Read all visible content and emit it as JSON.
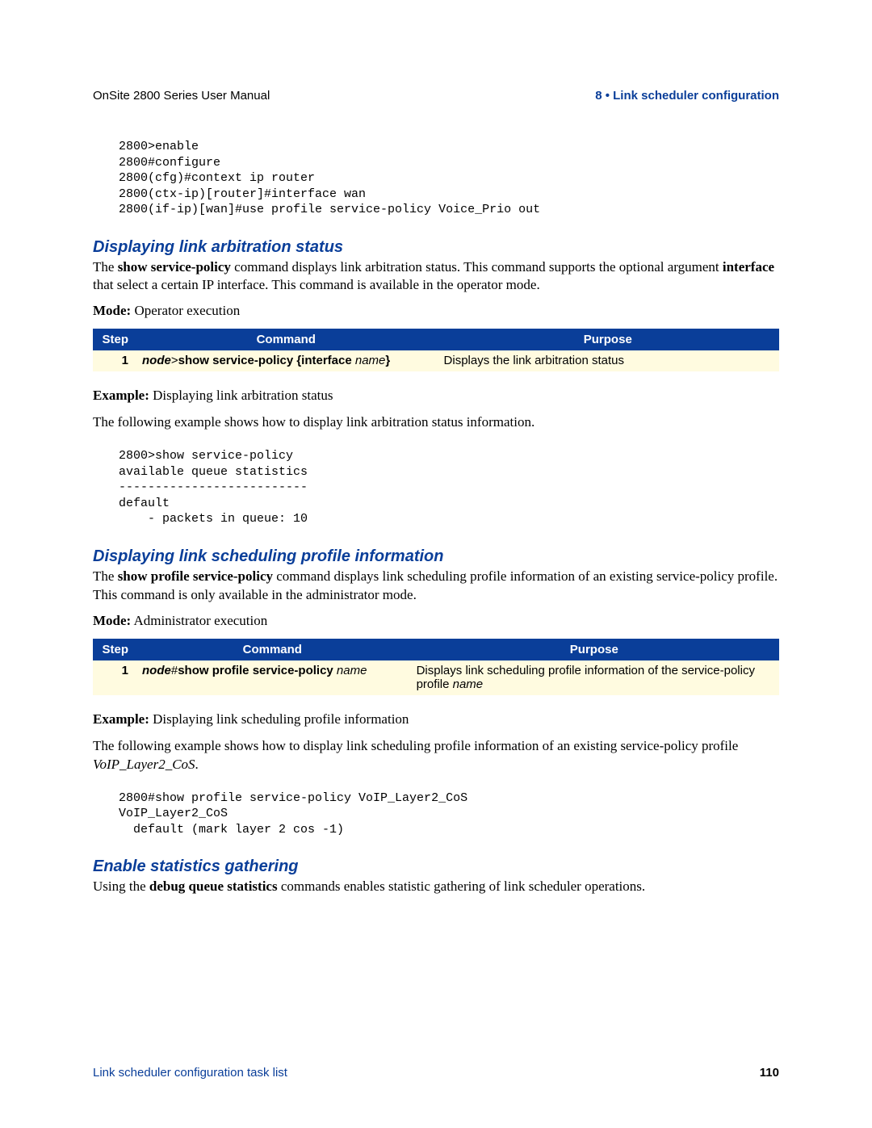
{
  "header": {
    "left": "OnSite 2800 Series User Manual",
    "right": "8 • Link scheduler configuration"
  },
  "code1": "2800>enable\n2800#configure\n2800(cfg)#context ip router\n2800(ctx-ip)[router]#interface wan\n2800(if-ip)[wan]#use profile service-policy Voice_Prio out",
  "sec1": {
    "title": "Displaying link arbitration status",
    "p1a": "The ",
    "p1b": "show service-policy",
    "p1c": " command displays link arbitration status. This command supports the optional argument ",
    "p1d": "interface",
    "p1e": " that select a certain IP interface. This command is available in the operator mode.",
    "mode_label": "Mode:",
    "mode_value": " Operator execution",
    "table": {
      "th_step": "Step",
      "th_command": "Command",
      "th_purpose": "Purpose",
      "step": "1",
      "cmd_a": "node",
      "cmd_b": ">",
      "cmd_c": "show service-policy {interface ",
      "cmd_d": "name",
      "cmd_e": "}",
      "purpose": "Displays the link arbitration status"
    },
    "example_label": "Example:",
    "example_value": " Displaying link arbitration status",
    "p2": "The following example shows how to display link arbitration status information.",
    "code": "2800>show service-policy\navailable queue statistics\n--------------------------\ndefault\n    - packets in queue: 10"
  },
  "sec2": {
    "title": "Displaying link scheduling profile information",
    "p1a": "The ",
    "p1b": "show profile service-policy",
    "p1c": " command displays link scheduling profile information of an existing service-policy profile. This command is only available in the administrator mode.",
    "mode_label": "Mode:",
    "mode_value": " Administrator execution",
    "table": {
      "th_step": "Step",
      "th_command": "Command",
      "th_purpose": "Purpose",
      "step": "1",
      "cmd_a": "node",
      "cmd_b": "#",
      "cmd_c": "show profile service-policy ",
      "cmd_d": "name",
      "purpose_a": "Displays link scheduling profile information of the service-policy profile ",
      "purpose_b": "name"
    },
    "example_label": "Example:",
    "example_value": " Displaying link scheduling profile information",
    "p2a": "The following example shows how to display link scheduling profile information of an existing service-policy profile ",
    "p2b": "VoIP_Layer2_CoS",
    "p2c": ".",
    "code": "2800#show profile service-policy VoIP_Layer2_CoS\nVoIP_Layer2_CoS\n  default (mark layer 2 cos -1)"
  },
  "sec3": {
    "title": "Enable statistics gathering",
    "p1a": "Using the ",
    "p1b": "debug queue statistics",
    "p1c": " commands enables statistic gathering of link scheduler operations."
  },
  "footer": {
    "left": "Link scheduler configuration task list",
    "right": "110"
  }
}
